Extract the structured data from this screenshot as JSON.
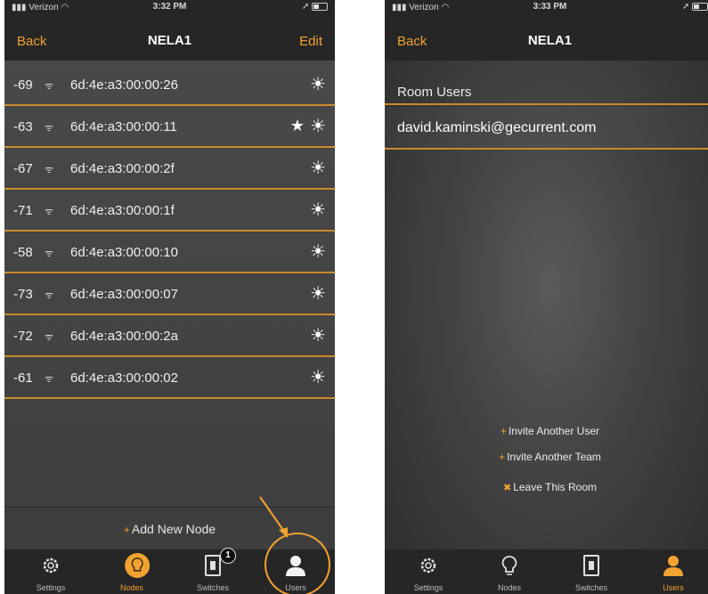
{
  "accent_color": "#f2a230",
  "screen1": {
    "status": {
      "carrier": "Verizon",
      "time": "3:32 PM"
    },
    "nav": {
      "back": "Back",
      "title": "NELA1",
      "edit": "Edit"
    },
    "nodes": [
      {
        "rssi": "-69",
        "mac": "6d:4e:a3:00:00:26",
        "starred": false
      },
      {
        "rssi": "-63",
        "mac": "6d:4e:a3:00:00:11",
        "starred": true
      },
      {
        "rssi": "-67",
        "mac": "6d:4e:a3:00:00:2f",
        "starred": false
      },
      {
        "rssi": "-71",
        "mac": "6d:4e:a3:00:00:1f",
        "starred": false
      },
      {
        "rssi": "-58",
        "mac": "6d:4e:a3:00:00:10",
        "starred": false
      },
      {
        "rssi": "-73",
        "mac": "6d:4e:a3:00:00:07",
        "starred": false
      },
      {
        "rssi": "-72",
        "mac": "6d:4e:a3:00:00:2a",
        "starred": false
      },
      {
        "rssi": "-61",
        "mac": "6d:4e:a3:00:00:02",
        "starred": false
      }
    ],
    "add_node": "Add New Node",
    "tabs": [
      {
        "label": "Settings",
        "icon": "gear-icon"
      },
      {
        "label": "Nodes",
        "icon": "lightbulb-icon",
        "active": true
      },
      {
        "label": "Switches",
        "icon": "switch-icon",
        "badge": "1"
      },
      {
        "label": "Users",
        "icon": "user-icon"
      }
    ]
  },
  "screen2": {
    "status": {
      "carrier": "Verizon",
      "time": "3:33 PM"
    },
    "nav": {
      "back": "Back",
      "title": "NELA1"
    },
    "section_title": "Room Users",
    "users": [
      "david.kaminski@gecurrent.com"
    ],
    "actions": {
      "invite_user": "Invite Another User",
      "invite_team": "Invite Another Team",
      "leave_room": "Leave This Room"
    },
    "tabs": [
      {
        "label": "Settings",
        "icon": "gear-icon"
      },
      {
        "label": "Nodes",
        "icon": "lightbulb-icon"
      },
      {
        "label": "Switches",
        "icon": "switch-icon"
      },
      {
        "label": "Users",
        "icon": "user-icon",
        "active": true
      }
    ]
  }
}
